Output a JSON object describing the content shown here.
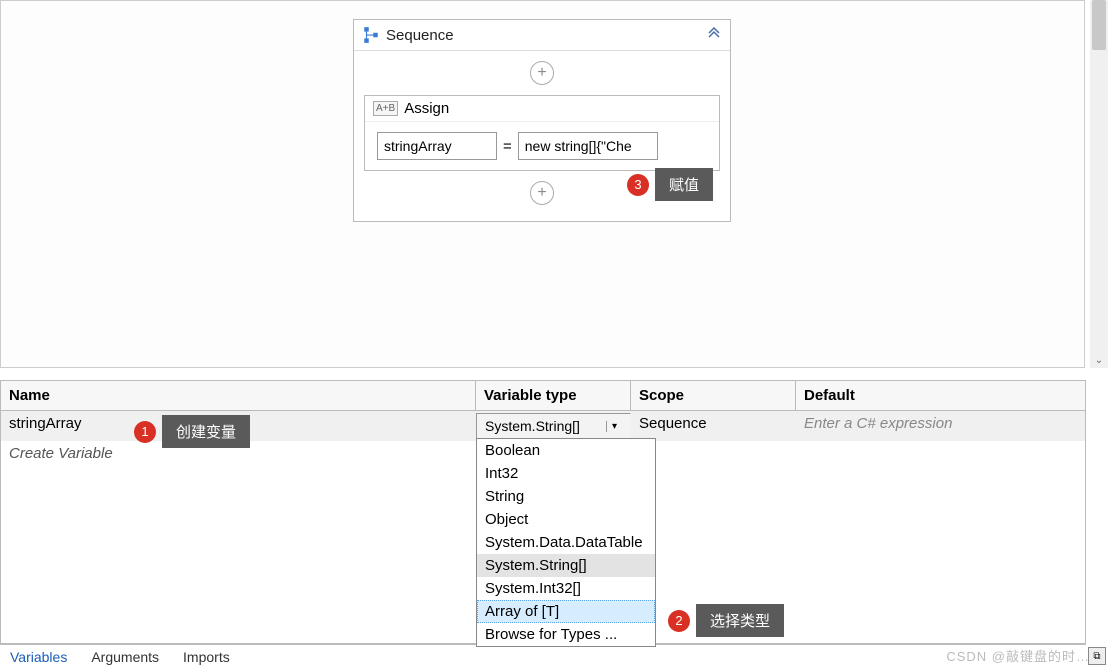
{
  "sequence": {
    "title": "Sequence",
    "assign": {
      "title": "Assign",
      "badge": "A+B",
      "left": "stringArray",
      "right": "new string[]{\"Che"
    }
  },
  "callouts": {
    "c1": {
      "num": "1",
      "label": "创建变量"
    },
    "c2": {
      "num": "2",
      "label": "选择类型"
    },
    "c3": {
      "num": "3",
      "label": "赋值"
    }
  },
  "variables": {
    "headers": {
      "name": "Name",
      "type": "Variable type",
      "scope": "Scope",
      "default": "Default"
    },
    "row": {
      "name": "stringArray",
      "type": "System.String[]",
      "scope": "Sequence",
      "default_placeholder": "Enter a C# expression"
    },
    "create_label": "Create Variable",
    "dropdown": {
      "items": [
        "Boolean",
        "Int32",
        "String",
        "Object",
        "System.Data.DataTable",
        "System.String[]",
        "System.Int32[]",
        "Array of [T]",
        "Browse for Types ..."
      ],
      "highlighted": "System.String[]",
      "selected": "Array of [T]"
    }
  },
  "tabs": {
    "variables": "Variables",
    "arguments": "Arguments",
    "imports": "Imports"
  },
  "watermark": "CSDN @敲键盘的时…"
}
